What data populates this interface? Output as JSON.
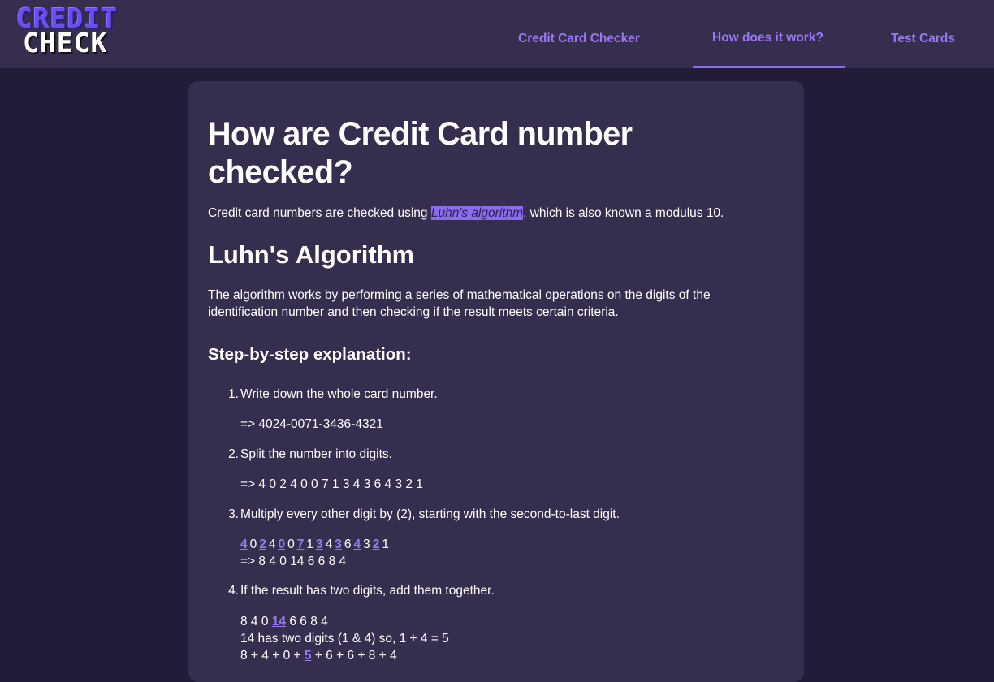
{
  "header": {
    "logo_line1": "CREDIT",
    "logo_line2": "CHECK",
    "nav": [
      "Credit Card Checker",
      "How does it work?",
      "Test Cards"
    ],
    "active_nav": "How does it work?"
  },
  "main": {
    "title": "How are Credit Card number checked?",
    "intro_before": "Credit card numbers are checked using ",
    "intro_link": "Luhn's algorithm",
    "intro_after": ", which is also known a modulus 10.",
    "subtitle": "Luhn's Algorithm",
    "description": "The algorithm works by performing a series of mathematical operations on the digits of the identification number and then checking if the result meets certain criteria.",
    "steps_title": "Step-by-step explanation:",
    "steps": [
      {
        "num": "1.",
        "text": "Write down the whole card number.",
        "result": "=> 4024-0071-3436-4321"
      },
      {
        "num": "2.",
        "text": "Split the number into digits.",
        "result": "=> 4 0 2 4 0 0 7 1 3 4 3 6 4 3 2 1"
      },
      {
        "num": "3.",
        "text": "Multiply every other digit by (2), starting with the second-to-last digit.",
        "digits": [
          "4",
          "0",
          "2",
          "4",
          "0",
          "0",
          "7",
          "1",
          "3",
          "4",
          "3",
          "6",
          "4",
          "3",
          "2",
          "1"
        ],
        "highlighted_indices": [
          0,
          2,
          4,
          6,
          8,
          10,
          12,
          14
        ],
        "result": "=> 8 4 0 14 6 6 8 4"
      },
      {
        "num": "4.",
        "text": "If the result has two digits, add them together.",
        "line1_before": "8 4 0 ",
        "line1_hl": "14",
        "line1_after": " 6 6 8 4",
        "line2": "14 has two digits (1 & 4) so, 1 + 4 = 5",
        "line3_before": "8 + 4 + 0 + ",
        "line3_hl": "5",
        "line3_after": " + 6 + 6 + 8 + 4"
      }
    ]
  },
  "colors": {
    "page_bg": "#221c38",
    "header_bg": "#372e4f",
    "card_bg": "#362e4e",
    "accent": "#8b6cf0",
    "nav_text": "#9a78f2"
  }
}
